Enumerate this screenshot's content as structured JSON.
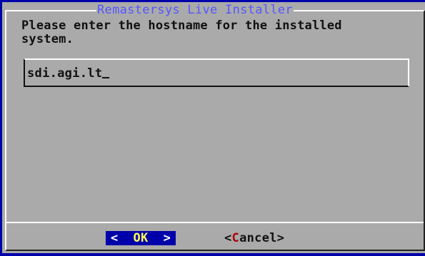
{
  "dialog": {
    "title": "Remastersys Live Installer",
    "prompt": "Please enter the hostname for the installed\nsystem.",
    "input": {
      "value": "sdi.agi.lt"
    },
    "buttons": {
      "ok": {
        "left": "<  ",
        "hotkey": "OK",
        "right": "  >"
      },
      "cancel": {
        "left": "<",
        "hotkey": "C",
        "rest": "ancel>"
      }
    }
  },
  "colors": {
    "screen_background": "#0000aa",
    "dialog_background": "#aaaaaa",
    "title": "#5555ff",
    "selected_button_background": "#0000aa",
    "selected_button_text": "#ffffff",
    "hotkey_selected": "#ffff55",
    "hotkey_unselected": "#aa0000"
  }
}
